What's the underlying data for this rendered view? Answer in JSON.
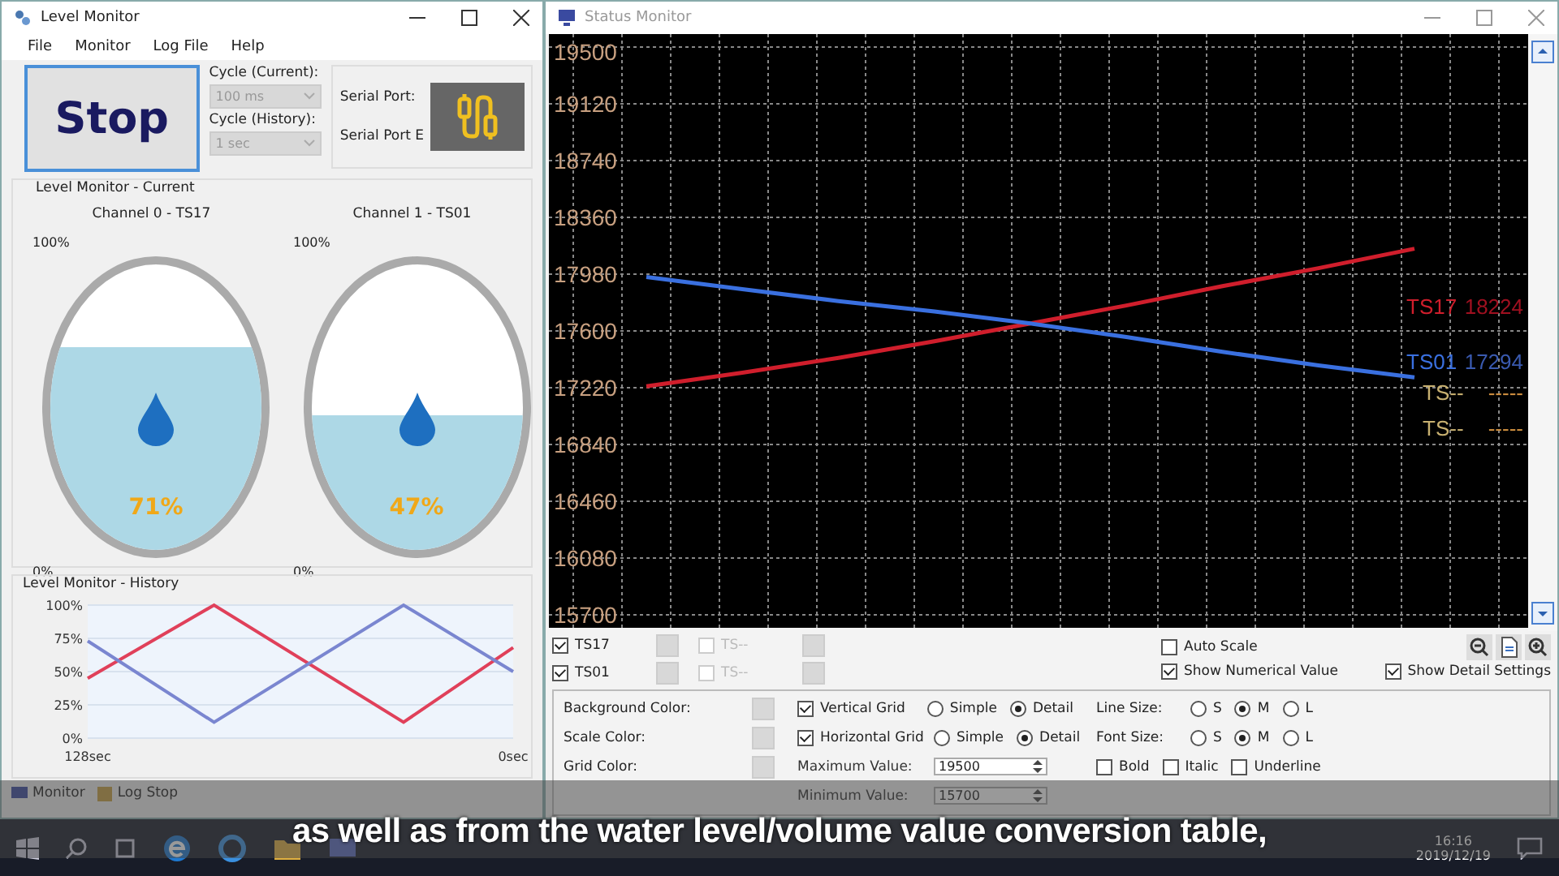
{
  "left_window": {
    "title": "Level Monitor",
    "menu": [
      "File",
      "Monitor",
      "Log File",
      "Help"
    ],
    "stop_button": "Stop",
    "cycles": [
      {
        "label": "Cycle (Current):",
        "value": "100 ms",
        "disabled": true
      },
      {
        "label": "Cycle (History):",
        "value": "1 sec",
        "disabled": true
      }
    ],
    "serial_port_labels": [
      "Serial Port:",
      "Serial Port E"
    ],
    "current": {
      "title": "Level Monitor - Current",
      "gauges": [
        {
          "channel": "Channel 0 - TS17",
          "max_label": "100%",
          "min_label": "0%",
          "level": 0.71,
          "reading": "71%"
        },
        {
          "channel": "Channel 1 - TS01",
          "max_label": "100%",
          "min_label": "0%",
          "level": 0.47,
          "reading": "47%"
        }
      ]
    },
    "history": {
      "title": "Level Monitor - History",
      "chart_data": {
        "type": "line",
        "grid": true,
        "x": [
          128,
          90,
          33,
          0
        ],
        "xlim": [
          128,
          0
        ],
        "xticks": [
          {
            "value": 128,
            "label": "128sec"
          },
          {
            "value": 0,
            "label": "0sec"
          }
        ],
        "ylim": [
          0,
          100
        ],
        "yticks": [
          {
            "value": 100,
            "label": "100%"
          },
          {
            "value": 75,
            "label": "75%"
          },
          {
            "value": 50,
            "label": "50%"
          },
          {
            "value": 25,
            "label": "25%"
          },
          {
            "value": 0,
            "label": "0%"
          }
        ],
        "series": [
          {
            "color": "#e0405a",
            "values": [
              45,
              100,
              12,
              68
            ]
          },
          {
            "color": "#7a86d0",
            "values": [
              73,
              12,
              100,
              50
            ]
          }
        ]
      }
    },
    "status_bar": [
      "Monitor",
      "Log Stop"
    ]
  },
  "right_window": {
    "title": "Status Monitor",
    "chart_data": {
      "type": "line",
      "grid": true,
      "ylim": [
        15700,
        19500
      ],
      "yticks": [
        15700,
        16080,
        16460,
        16840,
        17220,
        17600,
        17980,
        18360,
        18740,
        19120,
        19500
      ],
      "series": [
        {
          "name": "TS17",
          "color": "#d01e2c",
          "values": [
            17230,
            17320,
            17420,
            17530,
            17650,
            17770,
            17900,
            18020,
            18150
          ]
        },
        {
          "name": "TS01",
          "color": "#3a70e0",
          "values": [
            17960,
            17880,
            17800,
            17730,
            17650,
            17560,
            17460,
            17370,
            17290
          ]
        }
      ]
    },
    "series_readings": [
      {
        "text": "18224",
        "color": "#a01020"
      },
      {
        "text": "17294",
        "color": "#3a5ab0"
      }
    ],
    "empty_labels": [
      {
        "name": "TS--",
        "value": "-----",
        "color": "#c8b070"
      },
      {
        "name": "TS--",
        "value": "-----",
        "color": "#c8b070"
      }
    ],
    "channels": [
      {
        "name": "TS17",
        "checked": true,
        "disabled": false
      },
      {
        "name": "TS--",
        "checked": false,
        "disabled": true
      },
      {
        "name": "TS01",
        "checked": true,
        "disabled": false
      },
      {
        "name": "TS--",
        "checked": false,
        "disabled": true
      }
    ],
    "options": [
      {
        "label": "Auto Scale",
        "checked": false
      },
      {
        "label": "Show Numerical Value",
        "checked": true
      },
      {
        "label": "Show Detail Settings",
        "checked": true
      }
    ],
    "color_settings": [
      "Background Color:",
      "Scale Color:",
      "Grid Color:"
    ],
    "grids": [
      {
        "label": "Vertical Grid",
        "checked": true,
        "modes": [
          {
            "label": "Simple",
            "selected": false
          },
          {
            "label": "Detail",
            "selected": true
          }
        ]
      },
      {
        "label": "Horizontal Grid",
        "checked": true,
        "modes": [
          {
            "label": "Simple",
            "selected": false
          },
          {
            "label": "Detail",
            "selected": true
          }
        ]
      }
    ],
    "values": [
      {
        "label": "Maximum Value:",
        "value": "19500"
      },
      {
        "label": "Minimum Value:",
        "value": "15700"
      }
    ],
    "sizes": [
      {
        "label": "Line Size:",
        "options": [
          {
            "label": "S",
            "selected": false
          },
          {
            "label": "M",
            "selected": true
          },
          {
            "label": "L",
            "selected": false
          }
        ]
      },
      {
        "label": "Font Size:",
        "options": [
          {
            "label": "S",
            "selected": false
          },
          {
            "label": "M",
            "selected": true
          },
          {
            "label": "L",
            "selected": false
          }
        ]
      }
    ],
    "styles": [
      {
        "label": "Bold",
        "checked": false
      },
      {
        "label": "Italic",
        "checked": false
      },
      {
        "label": "Underline",
        "checked": false
      }
    ]
  },
  "caption": "as well as from the water level/volume value conversion table,",
  "taskbar": {
    "time": "16:16",
    "date": "2019/12/19"
  }
}
